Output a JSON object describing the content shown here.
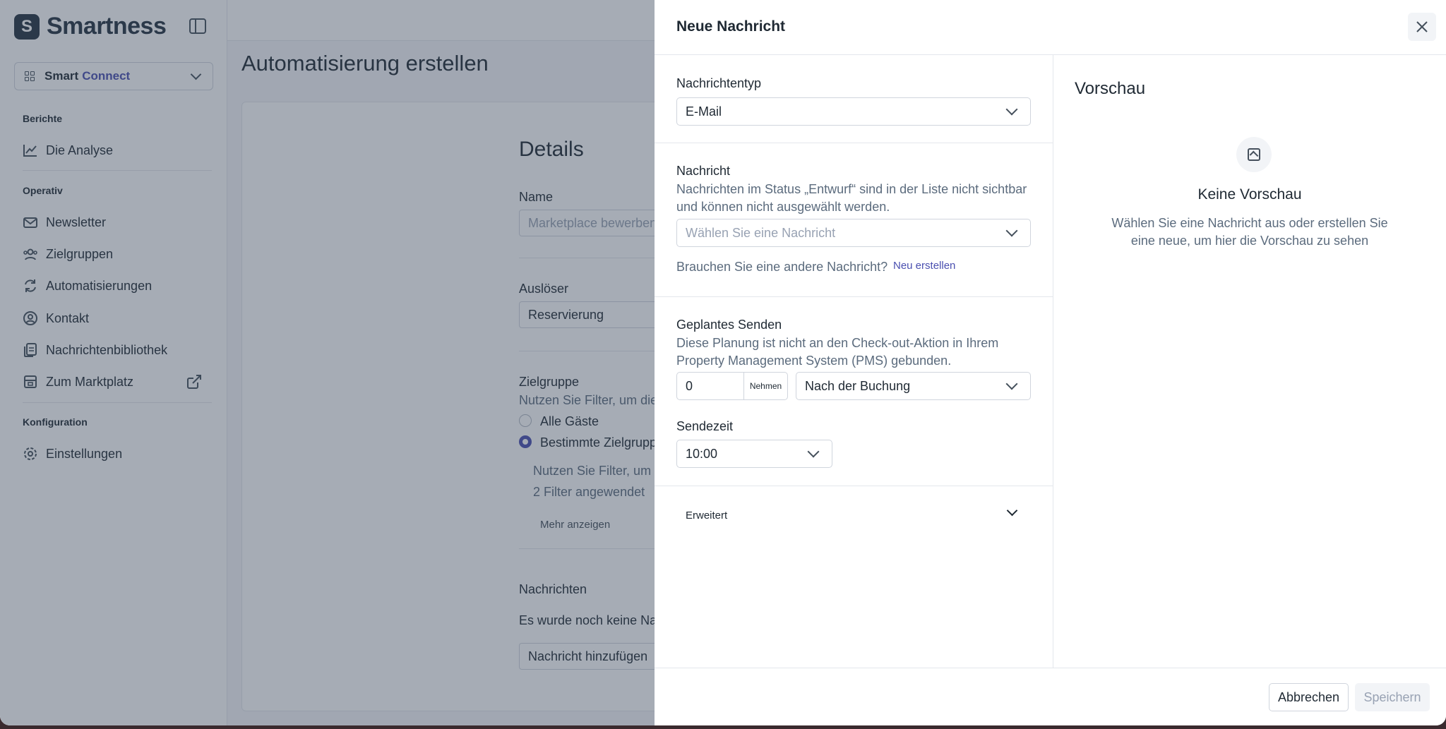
{
  "sidebar": {
    "brand": "Smartness",
    "logo_letter": "S",
    "app_switcher": {
      "prefix": "Smart",
      "product": "Connect"
    },
    "sections": {
      "reports": "Berichte",
      "operative": "Operativ",
      "config": "Konfiguration"
    },
    "items": {
      "analysis": "Die Analyse",
      "newsletter": "Newsletter",
      "audiences": "Zielgruppen",
      "automations": "Automatisierungen",
      "contact": "Kontakt",
      "library": "Nachrichtenbibliothek",
      "marketplace": "Zum Marktplatz",
      "settings": "Einstellungen"
    }
  },
  "main": {
    "page_title": "Automatisierung erstellen",
    "details_title": "Details",
    "name_label": "Name",
    "name_placeholder": "Marketplace bewerben",
    "trigger_label": "Auslöser",
    "trigger_value": "Reservierung",
    "audience_label": "Zielgruppe",
    "audience_hint": "Nutzen Sie Filter, um die",
    "all_guests": "Alle Gäste",
    "specific_audience": "Bestimmte Zielgruppe",
    "filter_hint": "Nutzen Sie Filter, um",
    "filters_applied": "2 Filter angewendet",
    "show_more": "Mehr anzeigen",
    "messages_label": "Nachrichten",
    "no_messages": "Es wurde noch keine Nachricht",
    "add_message": "Nachricht hinzufügen"
  },
  "modal": {
    "title": "Neue Nachricht",
    "message_type_label": "Nachrichtentyp",
    "message_type_value": "E-Mail",
    "message_label": "Nachricht",
    "message_hint": "Nachrichten im Status „Entwurf“ sind in der Liste nicht sichtbar und können nicht ausgewählt werden.",
    "message_placeholder": "Wählen Sie eine Nachricht",
    "need_other": "Brauchen Sie eine andere Nachricht?",
    "create_new": "Neu erstellen",
    "scheduled_label": "Geplantes Senden",
    "scheduled_hint": "Diese Planung ist nicht an den Check-out-Aktion in Ihrem Property Management System (PMS) gebunden.",
    "offset_value": "0",
    "offset_unit": "Nehmen",
    "relative_to": "Nach der Buchung",
    "send_time_label": "Sendezeit",
    "send_time_value": "10:00",
    "advanced": "Erweitert",
    "preview_title": "Vorschau",
    "no_preview": "Keine Vorschau",
    "no_preview_hint": "Wählen Sie eine Nachricht aus oder erstellen Sie eine neue, um hier die Vorschau zu sehen",
    "cancel": "Abbrechen",
    "save": "Speichern"
  },
  "colors": {
    "accent": "#4a4fb0",
    "overlay": "rgba(52,66,86,0.44)",
    "brand_dark": "#253241"
  }
}
